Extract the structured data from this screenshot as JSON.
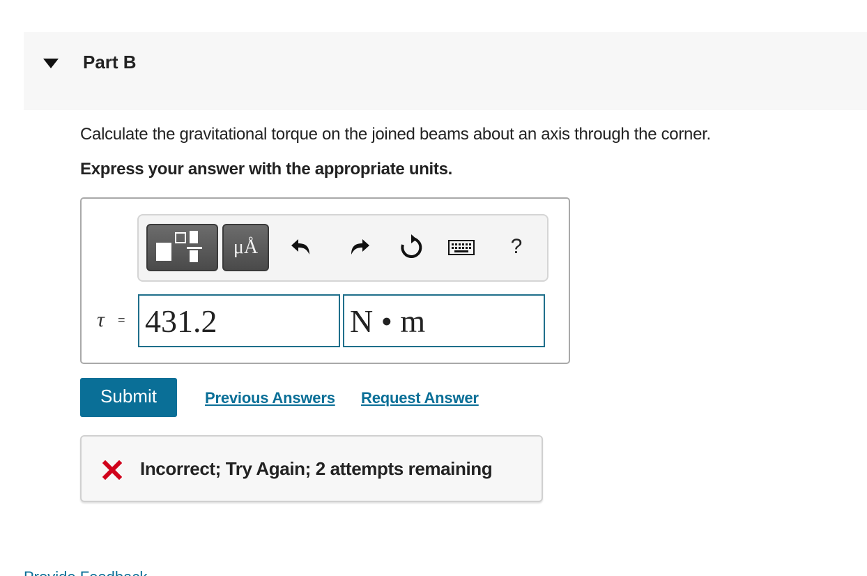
{
  "part": {
    "title": "Part B"
  },
  "question": {
    "text": "Calculate the gravitational torque on the joined beams about an axis through the corner.",
    "instruction": "Express your answer with the appropriate units."
  },
  "toolbar": {
    "templates_icon": "templates-icon",
    "units_label": "μÅ",
    "undo_icon": "undo-icon",
    "redo_icon": "redo-icon",
    "reset_icon": "reset-icon",
    "keyboard_icon": "keyboard-icon",
    "help_label": "?"
  },
  "answer": {
    "symbol": "τ",
    "equals": "=",
    "value": "431.2",
    "units": "N • m"
  },
  "actions": {
    "submit_label": "Submit",
    "previous_answers_label": "Previous Answers",
    "request_answer_label": "Request Answer"
  },
  "feedback": {
    "message": "Incorrect; Try Again; 2 attempts remaining",
    "status_color": "#d0021b"
  },
  "footer": {
    "provide_feedback_label": "Provide Feedback"
  },
  "colors": {
    "accent": "#0a6f97",
    "input_border": "#1f6f8b"
  }
}
